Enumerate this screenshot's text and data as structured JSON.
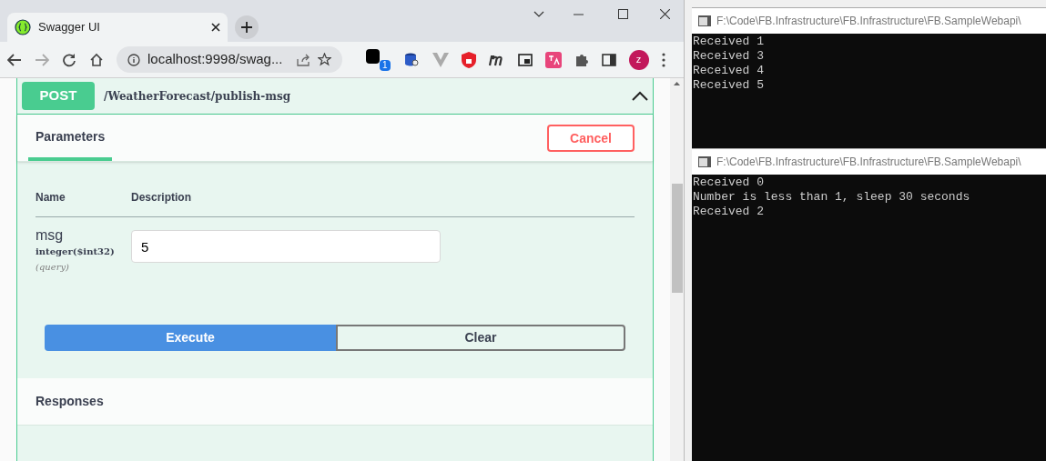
{
  "browser": {
    "tab_title": "Swagger UI",
    "address": "localhost:9998/swag...",
    "extension_badge": "1",
    "profile_initial": "z"
  },
  "operation": {
    "method": "POST",
    "path": "/WeatherForecast/publish-msg",
    "expanded": true,
    "section_tabs": [
      {
        "label": "Parameters",
        "selected": true
      }
    ],
    "cancel_button": "Cancel",
    "columns": [
      "Name",
      "Description"
    ],
    "parameters": [
      {
        "name": "msg",
        "type": "integer($int32)",
        "location": "(query)",
        "value": "5"
      }
    ],
    "execute_button": "Execute",
    "clear_button": "Clear",
    "responses_title": "Responses"
  },
  "consoles": [
    {
      "title": "F:\\Code\\FB.Infrastructure\\FB.Infrastructure\\FB.SampleWebapi\\",
      "lines": [
        "Received 1",
        "Received 3",
        "Received 4",
        "Received 5"
      ]
    },
    {
      "title": "F:\\Code\\FB.Infrastructure\\FB.Infrastructure\\FB.SampleWebapi\\",
      "lines": [
        "Received 0",
        "Number is less than 1, sleep 30 seconds",
        "Received 2"
      ]
    }
  ]
}
